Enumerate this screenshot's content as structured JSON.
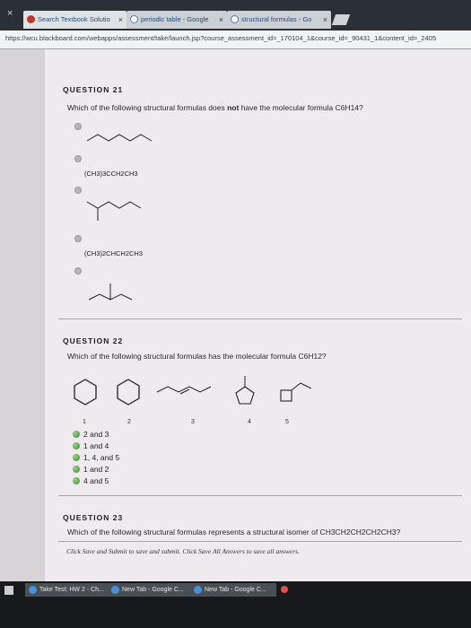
{
  "browser": {
    "tabs": [
      {
        "label": "Search Textbook Solutio"
      },
      {
        "label": "periodic table - Google"
      },
      {
        "label": "structural formulas - Go"
      }
    ],
    "url": "https://wcu.blackboard.com/webapps/assessment/take/launch.jsp?course_assessment_id=_170104_1&course_id=_90431_1&content_id=_2405"
  },
  "q21": {
    "heading": "QUESTION 21",
    "text_before": "Which of the following structural formulas does ",
    "text_bold": "not",
    "text_after": " have the molecular formula C6H14?",
    "options": [
      {
        "type": "skeletal",
        "name": "hexane"
      },
      {
        "type": "text",
        "label": "(CH3)3CCH2CH3"
      },
      {
        "type": "skeletal",
        "name": "branched"
      },
      {
        "type": "text",
        "label": "(CH3)2CHCH2CH3"
      },
      {
        "type": "skeletal",
        "name": "branched-2"
      }
    ]
  },
  "q22": {
    "heading": "QUESTION 22",
    "text": "Which of the following structural formulas has the molecular formula C6H12?",
    "structure_numbers": [
      "1",
      "2",
      "3",
      "4",
      "5"
    ],
    "options": [
      "2 and 3",
      "1 and 4",
      "1, 4, and 5",
      "1 and 2",
      "4 and 5"
    ]
  },
  "q23": {
    "heading": "QUESTION 23",
    "text": "Which of the following structural formulas represents a structural isomer of CH3CH2CH2CH2CH3?"
  },
  "instructions": "Click Save and Submit to save and submit. Click Save All Answers to save all answers.",
  "taskbar": {
    "items": [
      "Take Test: HW 2 - Ch...",
      "New Tab - Google C...",
      "New Tab - Google C..."
    ]
  }
}
